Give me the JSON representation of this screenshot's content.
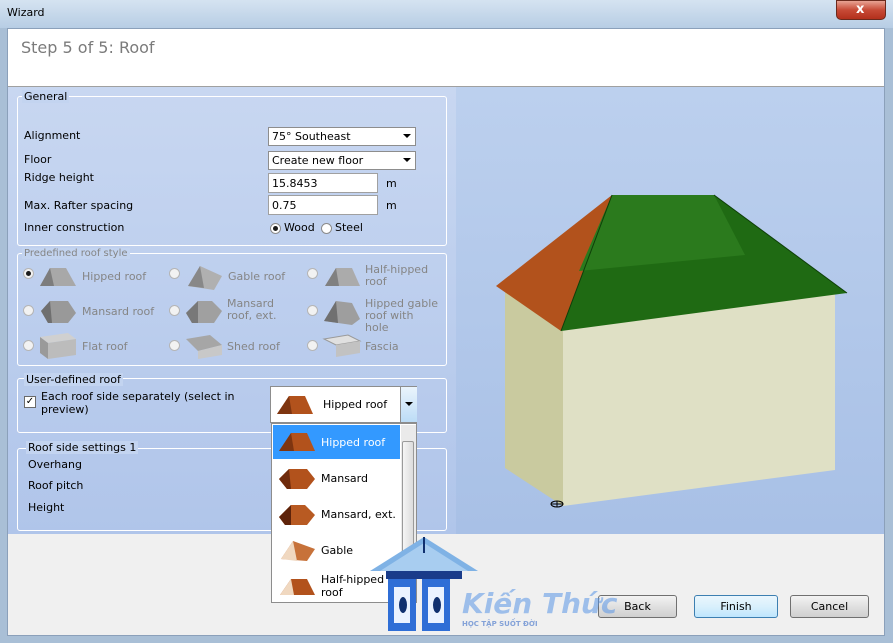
{
  "window": {
    "title": "Wizard",
    "close_label": "x"
  },
  "header": {
    "step_title": "Step 5 of 5:  Roof"
  },
  "general": {
    "legend": "General",
    "alignment_label": "Alignment",
    "alignment_value": "75° Southeast",
    "floor_label": "Floor",
    "floor_value": "Create new floor",
    "ridge_label": "Ridge height",
    "ridge_value": "15.8453",
    "ridge_unit": "m",
    "rafter_label": "Max. Rafter spacing",
    "rafter_value": "0.75",
    "rafter_unit": "m",
    "inner_label": "Inner construction",
    "inner_options": [
      "Wood",
      "Steel"
    ],
    "inner_selected": "Wood"
  },
  "predefined": {
    "legend": "Predefined roof style",
    "styles": [
      {
        "label": "Hipped roof",
        "icon": "hipped-roof-icon",
        "selected": true
      },
      {
        "label": "Gable roof",
        "icon": "gable-roof-icon",
        "selected": false
      },
      {
        "label": "Half-hipped roof",
        "icon": "half-hipped-roof-icon",
        "selected": false
      },
      {
        "label": "Mansard roof",
        "icon": "mansard-roof-icon",
        "selected": false
      },
      {
        "label": "Mansard roof, ext.",
        "icon": "mansard-ext-roof-icon",
        "selected": false
      },
      {
        "label": "Hipped gable roof with hole",
        "icon": "hipped-gable-hole-icon",
        "selected": false
      },
      {
        "label": "Flat roof",
        "icon": "flat-roof-icon",
        "selected": false
      },
      {
        "label": "Shed roof",
        "icon": "shed-roof-icon",
        "selected": false
      },
      {
        "label": "Fascia",
        "icon": "fascia-icon",
        "selected": false
      }
    ]
  },
  "user_defined": {
    "legend": "User-defined roof",
    "checkbox_label": "Each roof side separately (select in preview)",
    "checked": true,
    "combo_value": "Hipped roof"
  },
  "side_settings": {
    "legend": "Roof side settings 1",
    "overhang_label": "Overhang",
    "pitch_label": "Roof pitch",
    "height_label": "Height"
  },
  "dropdown": {
    "items": [
      "Hipped roof",
      "Mansard",
      "Mansard, ext.",
      "Gable",
      "Half-hipped roof"
    ],
    "selected": "Hipped roof"
  },
  "footer": {
    "back_label": "Back",
    "finish_label": "Finish",
    "cancel_label": "Cancel"
  },
  "watermark": {
    "brand": "Kiến Thức",
    "tagline": "HỌC TẬP SUỐT ĐỜI"
  },
  "colors": {
    "roof_green": "#1f6a13",
    "roof_brown": "#b2521c",
    "wall": "#dfe0c8",
    "selection": "#3399ff"
  }
}
